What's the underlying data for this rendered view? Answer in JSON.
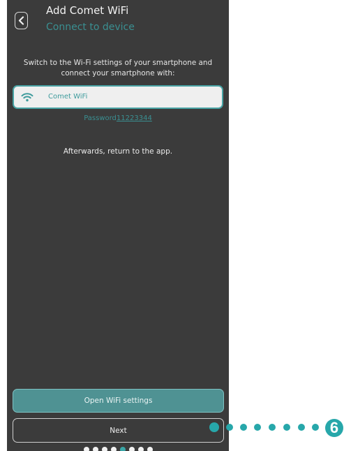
{
  "header": {
    "title": "Add Comet WiFi",
    "subtitle": "Connect to device",
    "back_icon": "chevron-left-icon"
  },
  "instructions": {
    "text": "Switch to the Wi-Fi settings of your smartphone and connect your smartphone with:"
  },
  "wifi_card": {
    "icon": "wifi-icon",
    "network_name": "Comet WiFi"
  },
  "password": {
    "label": "Password",
    "value": "11223344"
  },
  "afterwards": {
    "text": "Afterwards, return to the app."
  },
  "buttons": {
    "open_wifi_settings": "Open WiFi settings",
    "next": "Next"
  },
  "pagination": {
    "total": 8,
    "current": 4
  },
  "callout": {
    "step_number": "6"
  },
  "colors": {
    "background": "#3b3b3b",
    "accent": "#3a8f91",
    "callout": "#27a7aa"
  }
}
